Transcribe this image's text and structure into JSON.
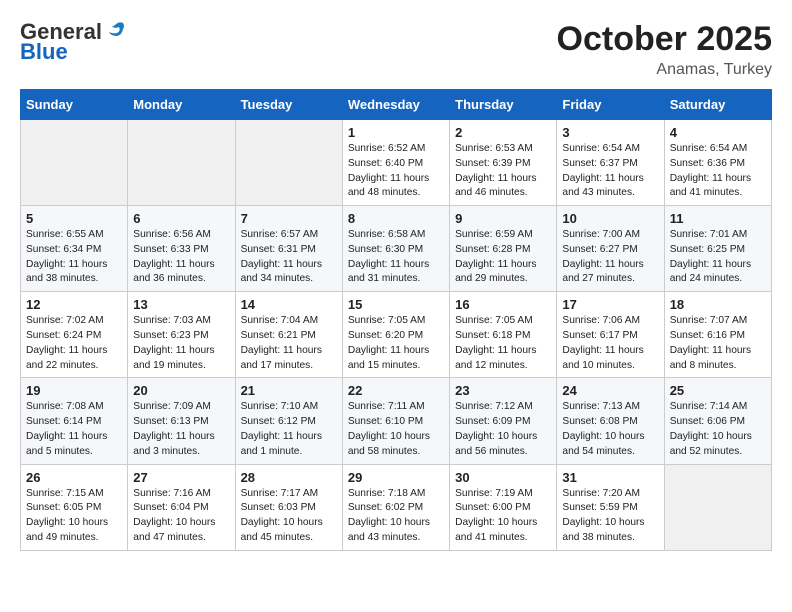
{
  "header": {
    "logo_general": "General",
    "logo_blue": "Blue",
    "month": "October 2025",
    "location": "Anamas, Turkey"
  },
  "days_of_week": [
    "Sunday",
    "Monday",
    "Tuesday",
    "Wednesday",
    "Thursday",
    "Friday",
    "Saturday"
  ],
  "weeks": [
    [
      {
        "day": "",
        "info": ""
      },
      {
        "day": "",
        "info": ""
      },
      {
        "day": "",
        "info": ""
      },
      {
        "day": "1",
        "info": "Sunrise: 6:52 AM\nSunset: 6:40 PM\nDaylight: 11 hours and 48 minutes."
      },
      {
        "day": "2",
        "info": "Sunrise: 6:53 AM\nSunset: 6:39 PM\nDaylight: 11 hours and 46 minutes."
      },
      {
        "day": "3",
        "info": "Sunrise: 6:54 AM\nSunset: 6:37 PM\nDaylight: 11 hours and 43 minutes."
      },
      {
        "day": "4",
        "info": "Sunrise: 6:54 AM\nSunset: 6:36 PM\nDaylight: 11 hours and 41 minutes."
      }
    ],
    [
      {
        "day": "5",
        "info": "Sunrise: 6:55 AM\nSunset: 6:34 PM\nDaylight: 11 hours and 38 minutes."
      },
      {
        "day": "6",
        "info": "Sunrise: 6:56 AM\nSunset: 6:33 PM\nDaylight: 11 hours and 36 minutes."
      },
      {
        "day": "7",
        "info": "Sunrise: 6:57 AM\nSunset: 6:31 PM\nDaylight: 11 hours and 34 minutes."
      },
      {
        "day": "8",
        "info": "Sunrise: 6:58 AM\nSunset: 6:30 PM\nDaylight: 11 hours and 31 minutes."
      },
      {
        "day": "9",
        "info": "Sunrise: 6:59 AM\nSunset: 6:28 PM\nDaylight: 11 hours and 29 minutes."
      },
      {
        "day": "10",
        "info": "Sunrise: 7:00 AM\nSunset: 6:27 PM\nDaylight: 11 hours and 27 minutes."
      },
      {
        "day": "11",
        "info": "Sunrise: 7:01 AM\nSunset: 6:25 PM\nDaylight: 11 hours and 24 minutes."
      }
    ],
    [
      {
        "day": "12",
        "info": "Sunrise: 7:02 AM\nSunset: 6:24 PM\nDaylight: 11 hours and 22 minutes."
      },
      {
        "day": "13",
        "info": "Sunrise: 7:03 AM\nSunset: 6:23 PM\nDaylight: 11 hours and 19 minutes."
      },
      {
        "day": "14",
        "info": "Sunrise: 7:04 AM\nSunset: 6:21 PM\nDaylight: 11 hours and 17 minutes."
      },
      {
        "day": "15",
        "info": "Sunrise: 7:05 AM\nSunset: 6:20 PM\nDaylight: 11 hours and 15 minutes."
      },
      {
        "day": "16",
        "info": "Sunrise: 7:05 AM\nSunset: 6:18 PM\nDaylight: 11 hours and 12 minutes."
      },
      {
        "day": "17",
        "info": "Sunrise: 7:06 AM\nSunset: 6:17 PM\nDaylight: 11 hours and 10 minutes."
      },
      {
        "day": "18",
        "info": "Sunrise: 7:07 AM\nSunset: 6:16 PM\nDaylight: 11 hours and 8 minutes."
      }
    ],
    [
      {
        "day": "19",
        "info": "Sunrise: 7:08 AM\nSunset: 6:14 PM\nDaylight: 11 hours and 5 minutes."
      },
      {
        "day": "20",
        "info": "Sunrise: 7:09 AM\nSunset: 6:13 PM\nDaylight: 11 hours and 3 minutes."
      },
      {
        "day": "21",
        "info": "Sunrise: 7:10 AM\nSunset: 6:12 PM\nDaylight: 11 hours and 1 minute."
      },
      {
        "day": "22",
        "info": "Sunrise: 7:11 AM\nSunset: 6:10 PM\nDaylight: 10 hours and 58 minutes."
      },
      {
        "day": "23",
        "info": "Sunrise: 7:12 AM\nSunset: 6:09 PM\nDaylight: 10 hours and 56 minutes."
      },
      {
        "day": "24",
        "info": "Sunrise: 7:13 AM\nSunset: 6:08 PM\nDaylight: 10 hours and 54 minutes."
      },
      {
        "day": "25",
        "info": "Sunrise: 7:14 AM\nSunset: 6:06 PM\nDaylight: 10 hours and 52 minutes."
      }
    ],
    [
      {
        "day": "26",
        "info": "Sunrise: 7:15 AM\nSunset: 6:05 PM\nDaylight: 10 hours and 49 minutes."
      },
      {
        "day": "27",
        "info": "Sunrise: 7:16 AM\nSunset: 6:04 PM\nDaylight: 10 hours and 47 minutes."
      },
      {
        "day": "28",
        "info": "Sunrise: 7:17 AM\nSunset: 6:03 PM\nDaylight: 10 hours and 45 minutes."
      },
      {
        "day": "29",
        "info": "Sunrise: 7:18 AM\nSunset: 6:02 PM\nDaylight: 10 hours and 43 minutes."
      },
      {
        "day": "30",
        "info": "Sunrise: 7:19 AM\nSunset: 6:00 PM\nDaylight: 10 hours and 41 minutes."
      },
      {
        "day": "31",
        "info": "Sunrise: 7:20 AM\nSunset: 5:59 PM\nDaylight: 10 hours and 38 minutes."
      },
      {
        "day": "",
        "info": ""
      }
    ]
  ]
}
